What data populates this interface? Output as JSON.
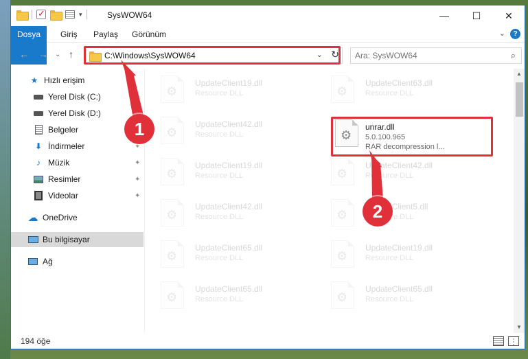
{
  "window": {
    "title": "SysWOW64",
    "controls": {
      "minimize": "—",
      "maximize": "☐",
      "close": "✕"
    }
  },
  "quick_access": {
    "dropdown": "▾"
  },
  "ribbon": {
    "tabs": [
      "Dosya",
      "Giriş",
      "Paylaş",
      "Görünüm"
    ],
    "help": "?",
    "collapse": "⌄"
  },
  "nav": {
    "back": "←",
    "forward": "→",
    "recent": "⌄",
    "up": "↑",
    "address": "C:\\Windows\\SysWOW64",
    "dropdown": "⌄",
    "refresh": "↻",
    "search_placeholder": "Ara: SysWOW64",
    "search_icon": "⌕"
  },
  "sidebar": {
    "items": [
      {
        "label": "Hızlı erişim",
        "icon": "star-icon",
        "pinned": false
      },
      {
        "label": "Yerel Disk (C:)",
        "icon": "drive-icon",
        "pinned": true
      },
      {
        "label": "Yerel Disk (D:)",
        "icon": "drive-icon",
        "pinned": true
      },
      {
        "label": "Belgeler",
        "icon": "document-icon",
        "pinned": true
      },
      {
        "label": "İndirmeler",
        "icon": "download-icon",
        "pinned": true
      },
      {
        "label": "Müzik",
        "icon": "music-icon",
        "pinned": true
      },
      {
        "label": "Resimler",
        "icon": "picture-icon",
        "pinned": true
      },
      {
        "label": "Videolar",
        "icon": "video-icon",
        "pinned": true
      },
      {
        "label": "OneDrive",
        "icon": "cloud-icon",
        "pinned": false
      },
      {
        "label": "Bu bilgisayar",
        "icon": "computer-icon",
        "pinned": false,
        "selected": true
      },
      {
        "label": "Ağ",
        "icon": "network-icon",
        "pinned": false
      }
    ],
    "pin_glyph": "📌"
  },
  "files": {
    "left": [
      {
        "name": "UpdateClient19.dll",
        "type": "Resource DLL"
      },
      {
        "name": "UpdateClient42.dll",
        "type": "Resource DLL"
      },
      {
        "name": "UpdateClient19.dll",
        "type": "Resource DLL"
      },
      {
        "name": "UpdateClient42.dll",
        "type": "Resource DLL"
      },
      {
        "name": "UpdateClient65.dll",
        "type": "Resource DLL"
      },
      {
        "name": "UpdateClient65.dll",
        "type": "Resource DLL"
      }
    ],
    "right": [
      {
        "name": "UpdateClient63.dll",
        "type": "Resource DLL"
      },
      {
        "name": "unrar.dll",
        "version": "5.0.100.965",
        "type": "RAR decompression l...",
        "highlighted": true
      },
      {
        "name": "UpdateClient42.dll",
        "type": "Resource DLL"
      },
      {
        "name": "UpdateClient5.dll",
        "type": "Resource DLL"
      },
      {
        "name": "UpdateClient19.dll",
        "type": "Resource DLL"
      },
      {
        "name": "UpdateClient65.dll",
        "type": "Resource DLL"
      }
    ]
  },
  "status": {
    "count": "194 öğe"
  },
  "callouts": [
    "1",
    "2"
  ],
  "colors": {
    "accent": "#1979ca",
    "highlight": "#e0313b"
  }
}
